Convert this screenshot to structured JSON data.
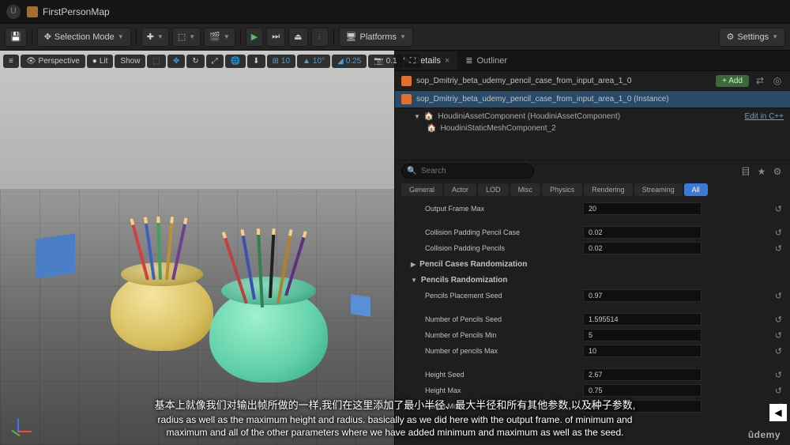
{
  "topbar": {
    "map_name": "FirstPersonMap"
  },
  "toolbar": {
    "save_icon": "save-icon",
    "selection_mode": "Selection Mode",
    "platforms": "Platforms",
    "settings": "Settings"
  },
  "viewport": {
    "perspective": "Perspective",
    "lit": "Lit",
    "show": "Show",
    "grid_snap": "10",
    "angle_snap": "10°",
    "scale_snap": "0.25",
    "cam_speed": "0.1"
  },
  "panels": {
    "details": "Details",
    "outliner": "Outliner"
  },
  "details": {
    "asset_name": "sop_Dmitriy_beta_udemy_pencil_case_from_input_area_1_0",
    "instance_name": "sop_Dmitriy_beta_udemy_pencil_case_from_input_area_1_0 (Instance)",
    "add_btn": "Add",
    "components": {
      "root": "HoudiniAssetComponent (HoudiniAssetComponent)",
      "child": "HoudiniStaticMeshComponent_2",
      "edit_link": "Edit in C++"
    },
    "search_placeholder": "Search",
    "filters": [
      "General",
      "Actor",
      "LOD",
      "Misc",
      "Physics",
      "Rendering",
      "Streaming",
      "All"
    ],
    "active_filter": "All",
    "props": {
      "output_frame_max": {
        "label": "Output Frame Max",
        "value": "20"
      },
      "collision_padding_case": {
        "label": "Collision Padding Pencil Case",
        "value": "0.02"
      },
      "collision_padding_pencils": {
        "label": "Collision Padding Pencils",
        "value": "0.02"
      },
      "cat_cases": "Pencil Cases Randomization",
      "cat_pencils": "Pencils Randomization",
      "pencils_placement_seed": {
        "label": "Pencils Placement Seed",
        "value": "0.97"
      },
      "num_pencils_seed": {
        "label": "Number of Pencils Seed",
        "value": "1.595514"
      },
      "num_pencils_min": {
        "label": "Number of Pencils Min",
        "value": "5"
      },
      "num_pencils_max": {
        "label": "Number of pencils Max",
        "value": "10"
      },
      "height_seed": {
        "label": "Height Seed",
        "value": "2.67"
      },
      "height_max": {
        "label": "Height Max",
        "value": "0.75"
      },
      "height_min": {
        "label": "Height Min",
        "value": "0.6"
      }
    }
  },
  "subtitles": {
    "cn": "基本上就像我们对输出帧所做的一样,我们在这里添加了最小半径、最大半径和所有其他参数,以及种子参数,",
    "en1": "radius as well as the maximum height and radius. basically as we did here with the output frame. of minimum and",
    "en2": "maximum and all of the other parameters where we have added minimum and maximum as well as the seed."
  },
  "brand": "ûdemy"
}
